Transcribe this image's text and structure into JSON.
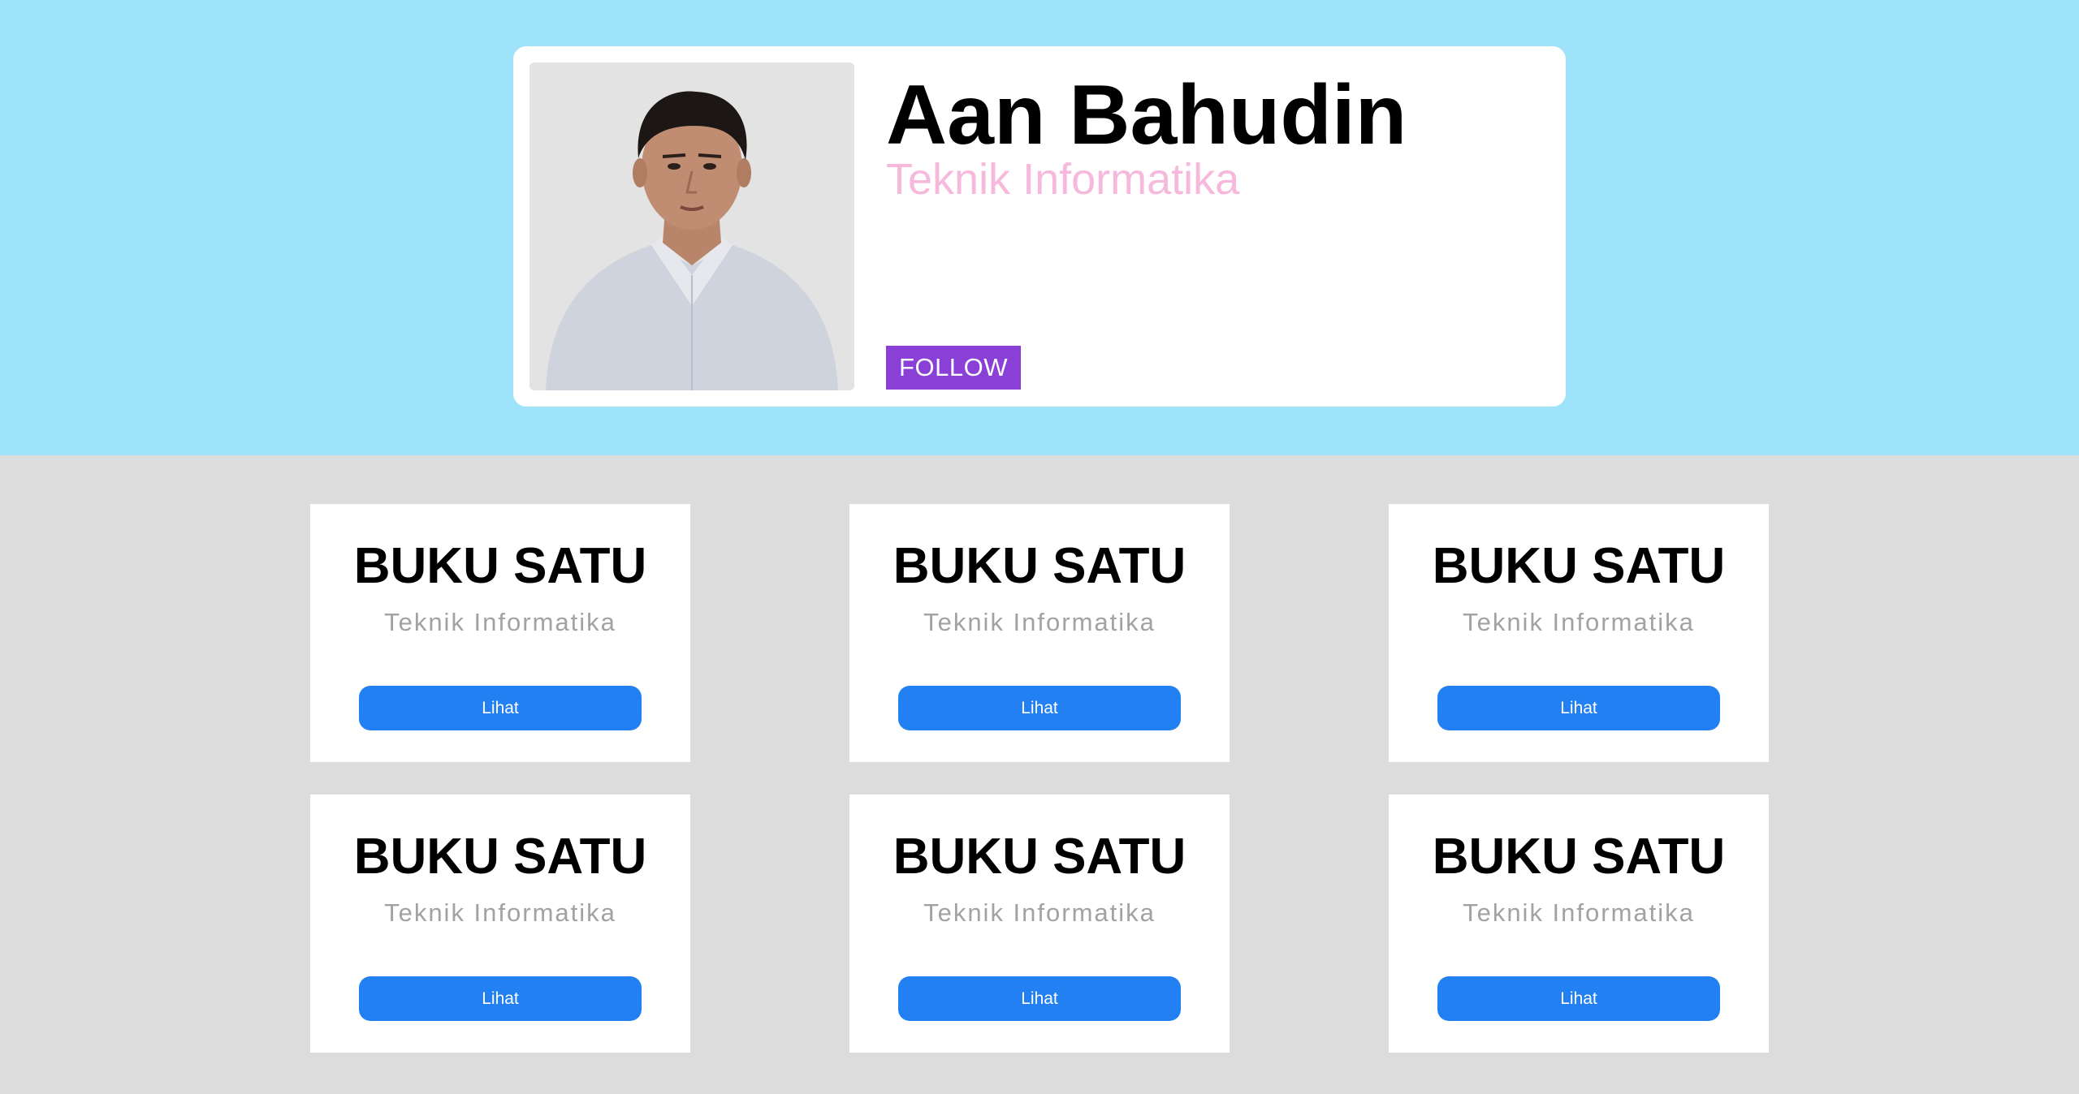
{
  "profile": {
    "name": "Aan Bahudin",
    "department": "Teknik Informatika",
    "follow_label": "FOLLOW",
    "photo_icon": "person-photo"
  },
  "books": [
    {
      "title": "BUKU SATU",
      "subtitle": "Teknik Informatika",
      "button_label": "Lihat"
    },
    {
      "title": "BUKU SATU",
      "subtitle": "Teknik Informatika",
      "button_label": "Lihat"
    },
    {
      "title": "BUKU SATU",
      "subtitle": "Teknik Informatika",
      "button_label": "Lihat"
    },
    {
      "title": "BUKU SATU",
      "subtitle": "Teknik Informatika",
      "button_label": "Lihat"
    },
    {
      "title": "BUKU SATU",
      "subtitle": "Teknik Informatika",
      "button_label": "Lihat"
    },
    {
      "title": "BUKU SATU",
      "subtitle": "Teknik Informatika",
      "button_label": "Lihat"
    }
  ],
  "colors": {
    "header_bg": "#9ee3fa",
    "page_bg": "#dcdcdc",
    "department_text": "#f6b9dc",
    "follow_button": "#8a3fd6",
    "lihat_button": "#2380f3"
  }
}
